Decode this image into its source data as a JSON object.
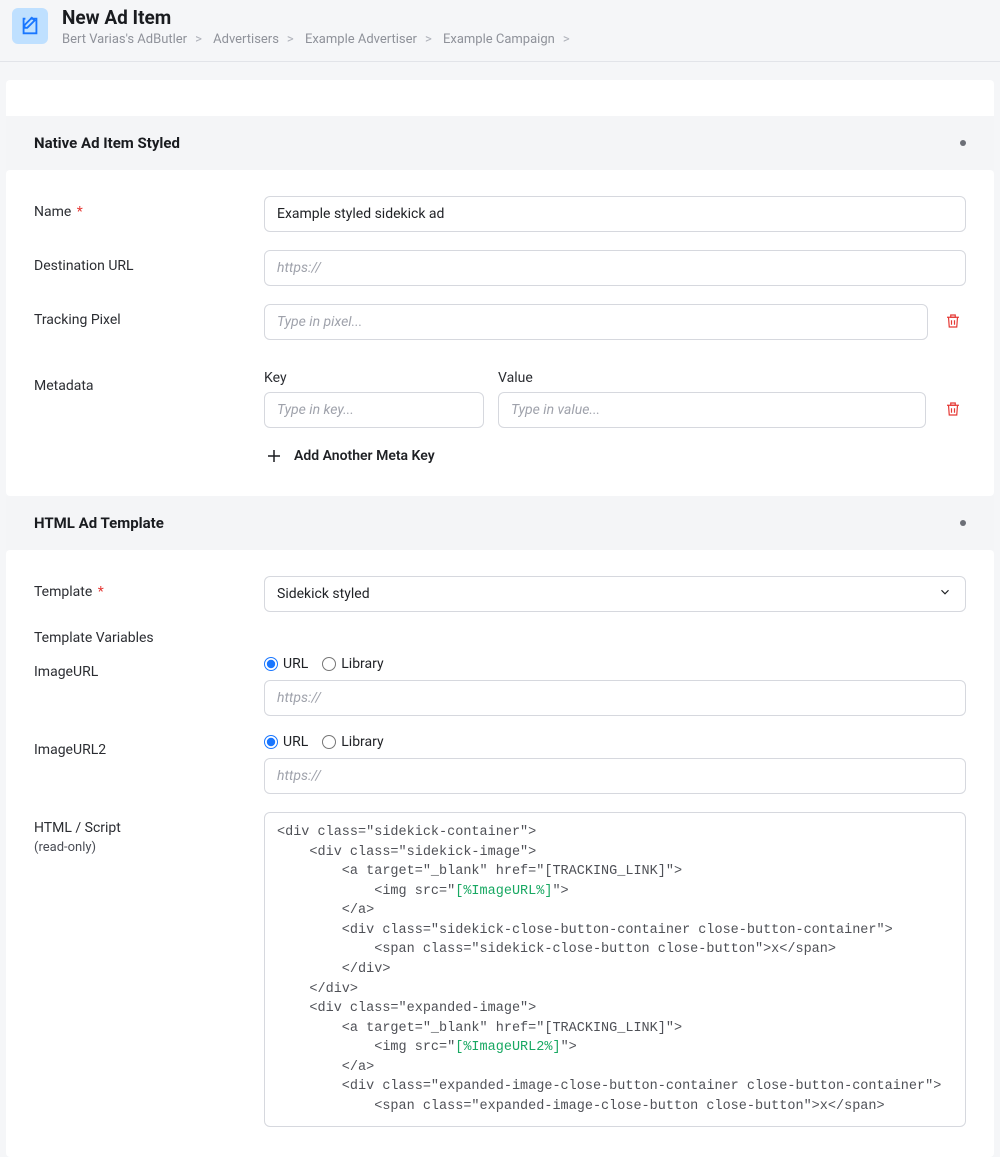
{
  "header": {
    "title": "New Ad Item",
    "breadcrumb": [
      "Bert Varias's AdButler",
      "Advertisers",
      "Example Advertiser",
      "Example Campaign"
    ]
  },
  "section1": {
    "title": "Native Ad Item Styled",
    "name_label": "Name",
    "name_value": "Example styled sidekick ad",
    "dest_label": "Destination URL",
    "dest_placeholder": "https://",
    "pixel_label": "Tracking Pixel",
    "pixel_placeholder": "Type in pixel...",
    "meta_label": "Metadata",
    "meta_key_head": "Key",
    "meta_val_head": "Value",
    "meta_key_placeholder": "Type in key...",
    "meta_val_placeholder": "Type in value...",
    "add_meta_label": "Add Another Meta Key"
  },
  "section2": {
    "title": "HTML Ad Template",
    "template_label": "Template",
    "template_value": "Sidekick styled",
    "tv_heading": "Template Variables",
    "imgurl_label": "ImageURL",
    "imgurl2_label": "ImageURL2",
    "opt_url": "URL",
    "opt_library": "Library",
    "img_placeholder": "https://",
    "html_label": "HTML / Script",
    "html_sub": "(read-only)",
    "code_pre1": "<div class=\"sidekick-container\">\n    <div class=\"sidekick-image\">\n        <a target=\"_blank\" href=\"[TRACKING_LINK]\">\n            <img src=\"",
    "code_var1": "[%ImageURL%]",
    "code_mid1": "\">\n        </a>\n        <div class=\"sidekick-close-button-container close-button-container\">\n            <span class=\"sidekick-close-button close-button\">x</span>\n        </div>\n    </div>\n    <div class=\"expanded-image\">\n        <a target=\"_blank\" href=\"[TRACKING_LINK]\">\n            <img src=\"",
    "code_var2": "[%ImageURL2%]",
    "code_post2": "\">\n        </a>\n        <div class=\"expanded-image-close-button-container close-button-container\">\n            <span class=\"expanded-image-close-button close-button\">x</span>"
  }
}
